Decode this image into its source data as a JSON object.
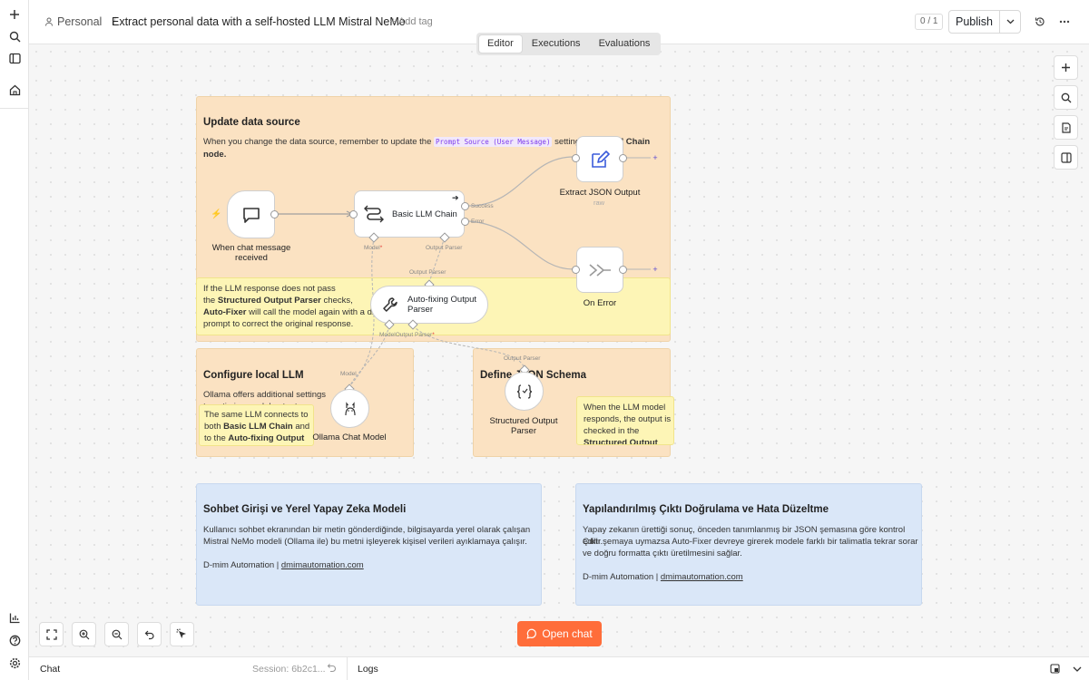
{
  "breadcrumb": {
    "project": "Personal",
    "separator": "/"
  },
  "workflow": {
    "title": "Extract personal data with a self-hosted LLM Mistral NeMo",
    "add_tag": "+ Add tag"
  },
  "tabs": [
    "Editor",
    "Executions",
    "Evaluations"
  ],
  "active_tab": "Editor",
  "header": {
    "counter": "0 / 1",
    "publish": "Publish"
  },
  "stickies": {
    "update": {
      "title": "Update data source",
      "text_before": "When you change the data source, remember to update the ",
      "code": "Prompt Source (User Message)",
      "text_after": " setting in the ",
      "bold": "LLM Chain",
      "tail": "node."
    },
    "autofix_note": {
      "line1": "If the LLM response does not pass",
      "line2_pre": "the ",
      "line2_bold": "Structured Output Parser",
      "line2_post": " checks,",
      "line3_bold": "Auto-Fixer",
      "line3_post": " will call the model again with a different",
      "line4": "prompt to correct the original response."
    },
    "local_llm": {
      "title": "Configure local LLM",
      "line1": "Ollama offers additional settings",
      "line2": "to optimize model output"
    },
    "same_llm": {
      "line1": "The same LLM connects to",
      "line2_pre": "both ",
      "line2_bold": "Basic LLM Chain",
      "line2_post": " and",
      "line3_pre": "to the ",
      "line3_bold": "Auto-fixing Output"
    },
    "schema": {
      "title": "Define JSON Schema"
    },
    "schema_note": {
      "line1": "When the LLM model",
      "line2": "responds, the output is",
      "line3": "checked in the",
      "line4_bold": "Structured Output"
    },
    "blue_left": {
      "title": "Sohbet Girişi ve Yerel Yapay Zeka Modeli",
      "line1": "Kullanıcı sohbet ekranından bir metin gönderdiğinde, bilgisayarda yerel olarak çalışan",
      "line2": "Mistral NeMo modeli (Ollama ile) bu metni işleyerek kişisel verileri ayıklamaya çalışır.",
      "credit": "D-mim Automation | ",
      "link": "dmimautomation.com"
    },
    "blue_right": {
      "title": "Yapılandırılmış Çıktı Doğrulama ve Hata Düzeltme",
      "line1": "Yapay zekanın ürettiği sonuç, önceden tanımlanmış bir JSON şemasına göre kontrol edilir.",
      "line2": "Çıktı şemaya uymazsa Auto-Fixer devreye girerek modele farklı bir talimatla tekrar sorar",
      "line3": "ve doğru formatta çıktı üretilmesini sağlar.",
      "credit": "D-mim Automation | ",
      "link": "dmimautomation.com"
    }
  },
  "nodes": {
    "trigger": {
      "label_1": "When chat message",
      "label_2": "received"
    },
    "chain": {
      "label": "Basic LLM Chain",
      "success": "Success",
      "error": "Error",
      "model": "Model",
      "model_required": "*",
      "parser": "Output Parser"
    },
    "extract": {
      "label": "Extract JSON Output",
      "sub": "raw"
    },
    "on_error": {
      "label": "On Error"
    },
    "autofix": {
      "label_1": "Auto-fixing Output",
      "label_2": "Parser",
      "in_port": "Output Parser",
      "model": "Model",
      "parser": "Output Parser",
      "required": "*"
    },
    "ollama": {
      "label": "Ollama Chat Model",
      "port": "Model"
    },
    "structured": {
      "label_1": "Structured Output",
      "label_2": "Parser",
      "port": "Output Parser"
    }
  },
  "canvas": {
    "open_chat": "Open chat"
  },
  "bottom": {
    "chat": "Chat",
    "session": "Session: 6b2c1...",
    "logs": "Logs"
  }
}
